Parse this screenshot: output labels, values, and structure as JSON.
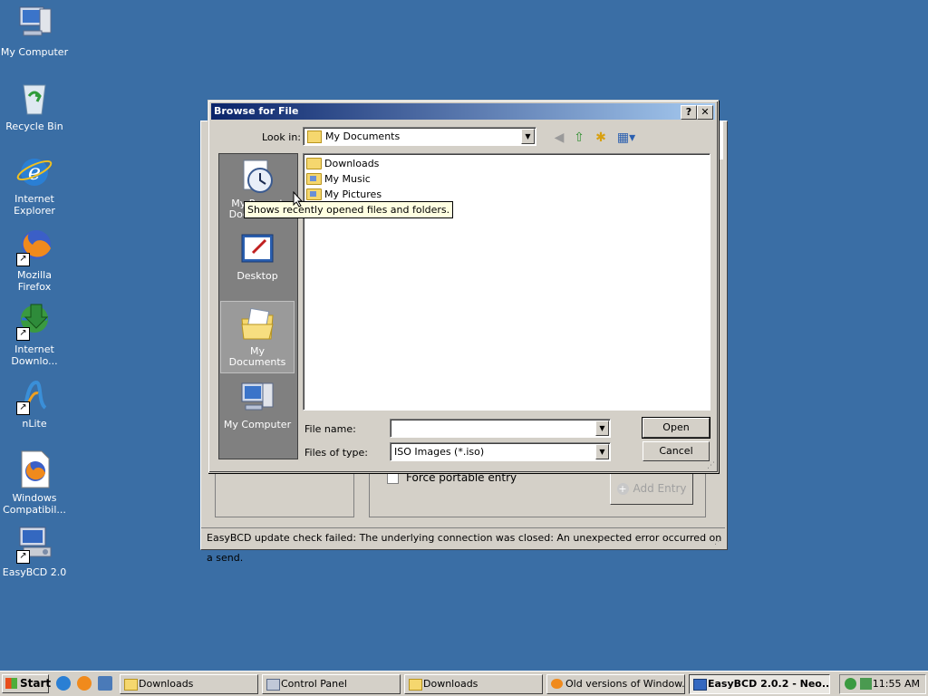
{
  "desktop": {
    "icons": [
      {
        "label": "My Computer",
        "icon": "my-computer-icon"
      },
      {
        "label": "Recycle Bin",
        "icon": "recycle-bin-icon"
      },
      {
        "label": "Internet Explorer",
        "icon": "internet-explorer-icon"
      },
      {
        "label": "Mozilla Firefox",
        "icon": "firefox-icon"
      },
      {
        "label": "Internet Downlo...",
        "icon": "internet-download-manager-icon"
      },
      {
        "label": "nLite",
        "icon": "nlite-icon"
      },
      {
        "label": "Windows Compatibil...",
        "icon": "firefox-document-icon"
      },
      {
        "label": "EasyBCD 2.0",
        "icon": "easybcd-icon"
      }
    ]
  },
  "easybcd": {
    "checkbox_label": "Force portable entry",
    "add_entry_label": "Add Entry",
    "status_text": "EasyBCD update check failed: The underlying connection was closed: An unexpected error occurred on a send."
  },
  "dialog": {
    "title": "Browse for File",
    "help_button": "?",
    "close_button": "✕",
    "look_in_label": "Look in:",
    "look_in_value": "My Documents",
    "places": [
      {
        "label": "My Recent Documents",
        "icon": "recent-documents-icon"
      },
      {
        "label": "Desktop",
        "icon": "desktop-icon"
      },
      {
        "label": "My Documents",
        "icon": "my-documents-icon"
      },
      {
        "label": "My Computer",
        "icon": "my-computer-icon"
      }
    ],
    "files": [
      {
        "name": "Downloads",
        "icon": "folder-icon"
      },
      {
        "name": "My Music",
        "icon": "music-folder-icon"
      },
      {
        "name": "My Pictures",
        "icon": "pictures-folder-icon"
      }
    ],
    "file_name_label": "File name:",
    "file_name_value": "",
    "file_type_label": "Files of type:",
    "file_type_value": "ISO Images (*.iso)",
    "open_button": "Open",
    "cancel_button": "Cancel",
    "tooltip": "Shows recently opened files and folders."
  },
  "taskbar": {
    "start_label": "Start",
    "tasks": [
      {
        "label": "Downloads",
        "icon": "folder-icon",
        "active": false
      },
      {
        "label": "Control Panel",
        "icon": "control-panel-icon",
        "active": false
      },
      {
        "label": "Downloads",
        "icon": "folder-icon",
        "active": false
      },
      {
        "label": "Old versions of Window...",
        "icon": "firefox-icon",
        "active": false
      },
      {
        "label": "EasyBCD 2.0.2  - Neo...",
        "icon": "easybcd-icon",
        "active": true
      }
    ],
    "clock": "11:55 AM"
  },
  "colors": {
    "desktop": "#3a6ea5",
    "titlebar_start": "#0a246a",
    "titlebar_end": "#a6caf0",
    "face": "#d4d0c8",
    "tooltip": "#ffffe1"
  }
}
